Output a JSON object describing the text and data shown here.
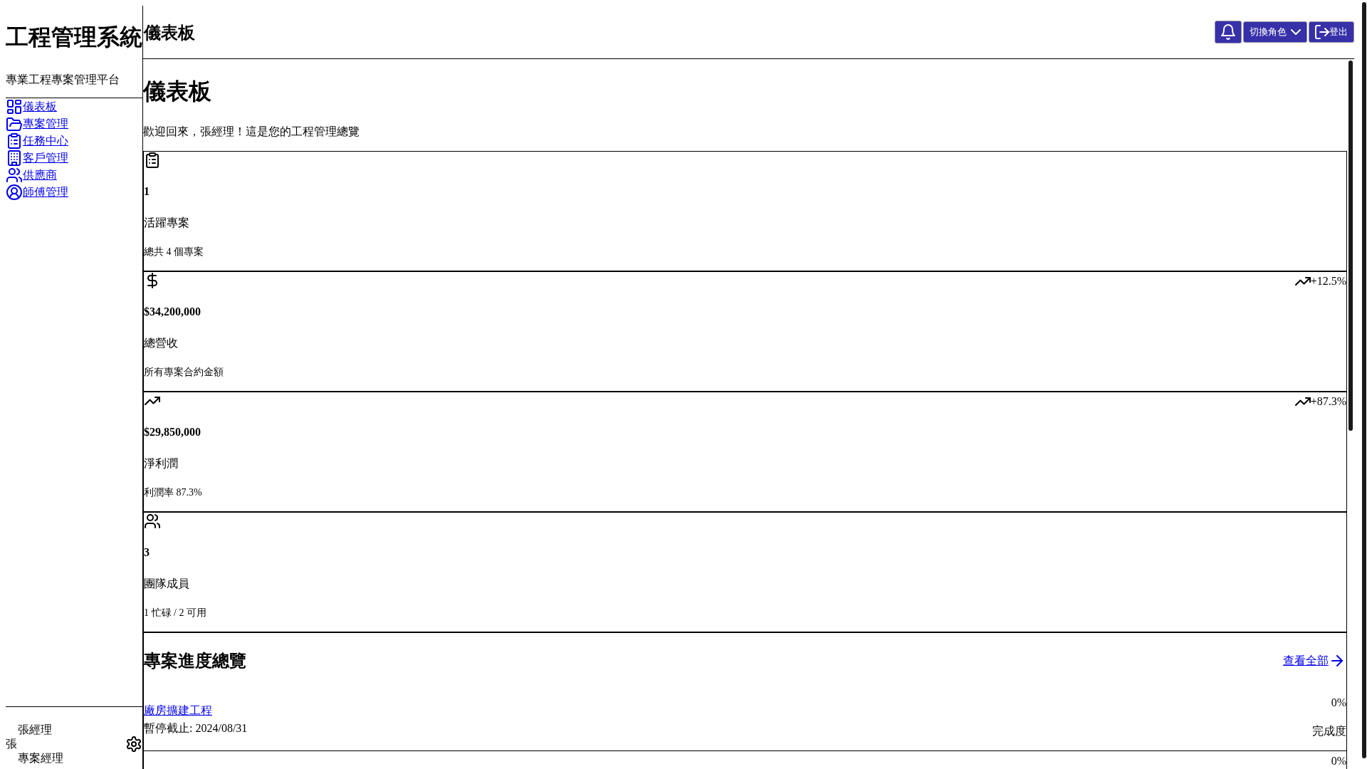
{
  "sidebar": {
    "title": "工程管理系統",
    "subtitle": "專業工程專案管理平台",
    "nav": [
      {
        "label": "儀表板"
      },
      {
        "label": "專案管理"
      },
      {
        "label": "任務中心"
      },
      {
        "label": "客戶管理"
      },
      {
        "label": "供應商"
      },
      {
        "label": "師傅管理"
      }
    ],
    "user": {
      "avatar": "張",
      "name": "張經理",
      "role": "專案經理"
    }
  },
  "header": {
    "title": "儀表板",
    "role_button": "切換角色",
    "logout_button": "登出"
  },
  "page": {
    "title": "儀表板",
    "welcome": "歡迎回來，張經理！這是您的工程管理總覽"
  },
  "stats": [
    {
      "value": "1",
      "label": "活躍專案",
      "note": "總共 4 個專案"
    },
    {
      "value": "$34,200,000",
      "label": "總營收",
      "note": "所有專案合約金額",
      "trend": "+12.5%"
    },
    {
      "value": "$29,850,000",
      "label": "淨利潤",
      "note": "利潤率 87.3%",
      "trend": "+87.3%"
    },
    {
      "value": "3",
      "label": "團隊成員",
      "note": "1 忙碌 / 2 可用"
    }
  ],
  "progress": {
    "title": "專案進度總覽",
    "view_all": "查看全部",
    "projects": [
      {
        "name": "廠房擴建工程",
        "deadline": "暫停截止: 2024/08/31",
        "percent": "0%",
        "percent_label": "完成度"
      },
      {
        "percent": "0%"
      }
    ]
  }
}
